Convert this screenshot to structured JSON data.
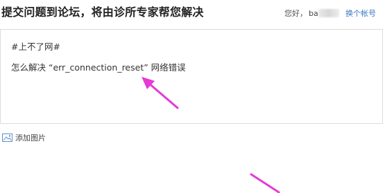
{
  "header": {
    "title": "提交问题到论坛，将由诊所专家帮您解决",
    "greeting": "您好，",
    "username": "ba",
    "switch_account": "换个帐号"
  },
  "editor": {
    "line1": "#上不了网#",
    "line2": "怎么解决 “err_connection_reset” 网络错误"
  },
  "toolbar": {
    "add_image_label": "添加图片",
    "image_icon": "image-icon"
  },
  "annotations": {
    "arrow_color": "#e63ad6"
  }
}
